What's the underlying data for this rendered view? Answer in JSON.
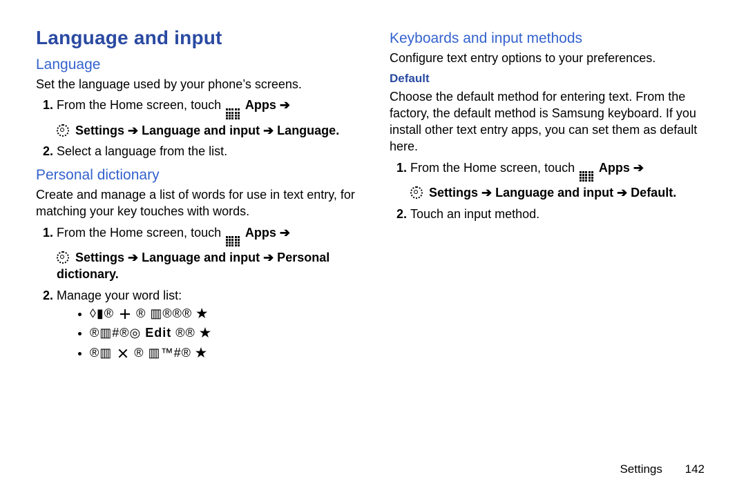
{
  "title": "Language and input",
  "left": {
    "h_language": "Language",
    "language_intro": "Set the language used by your phone’s screens.",
    "step1_pre": "From the Home screen, touch ",
    "apps_label": "Apps",
    "step1_path": "Settings ➔ Language and input ➔ Language",
    "step2": "Select a language from the list.",
    "h_personal": "Personal dictionary",
    "personal_intro": "Create and manage a list of words for use in text entry, for matching your key touches with words.",
    "p_step1_pre": "From the Home screen, touch ",
    "p_step1_path": "Settings ➔ Language and input ➔ Personal dictionary",
    "p_step2": "Manage your word list:",
    "glyph_a_pre": "◊▮® ",
    "glyph_a_post": " ® ▥®®®",
    "glyph_b_pre": "®▥#®◎ ",
    "glyph_b_mid": "Edit",
    "glyph_b_post": " ®®",
    "glyph_c_pre": "®▥ ",
    "glyph_c_post": " ® ▥™#®",
    "star": "★"
  },
  "right": {
    "h_kb": "Keyboards and input methods",
    "kb_intro": "Configure text entry options to your preferences.",
    "h_default": "Default",
    "default_intro": "Choose the default method for entering text. From the factory, the default method is Samsung keyboard. If you install other text entry apps, you can set them as default here.",
    "d_step1_pre": "From the Home screen, touch ",
    "d_step1_path": "Settings ➔ Language and input ➔ Default",
    "d_step2": "Touch an input method."
  },
  "footer": {
    "section": "Settings",
    "page": "142"
  },
  "symbols": {
    "arrow": "➔"
  }
}
